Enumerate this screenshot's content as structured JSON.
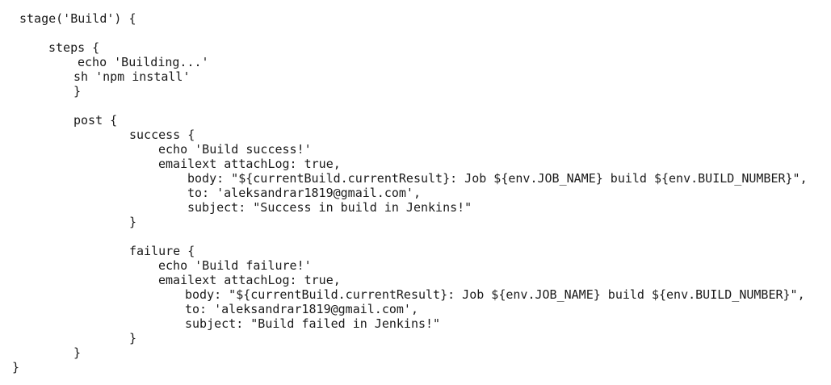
{
  "code": {
    "lines": [
      "stage('Build') {",
      "steps {",
      "echo 'Building...'",
      "sh 'npm install'",
      "}",
      "post {",
      "success {",
      "echo 'Build success!'",
      "emailext attachLog: true,",
      "body: \"${currentBuild.currentResult}: Job ${env.JOB_NAME} build ${env.BUILD_NUMBER}\",",
      "to: 'aleksandrar1819@gmail.com',",
      "subject: \"Success in build in Jenkins!\"",
      "}",
      "failure {",
      "echo 'Build failure!'",
      "emailext attachLog: true,",
      "body: \"${currentBuild.currentResult}: Job ${env.JOB_NAME} build ${env.BUILD_NUMBER}\",",
      "to: 'aleksandrar1819@gmail.com',",
      "subject: \"Build failed in Jenkins!\"",
      "}",
      "}",
      "}"
    ]
  }
}
